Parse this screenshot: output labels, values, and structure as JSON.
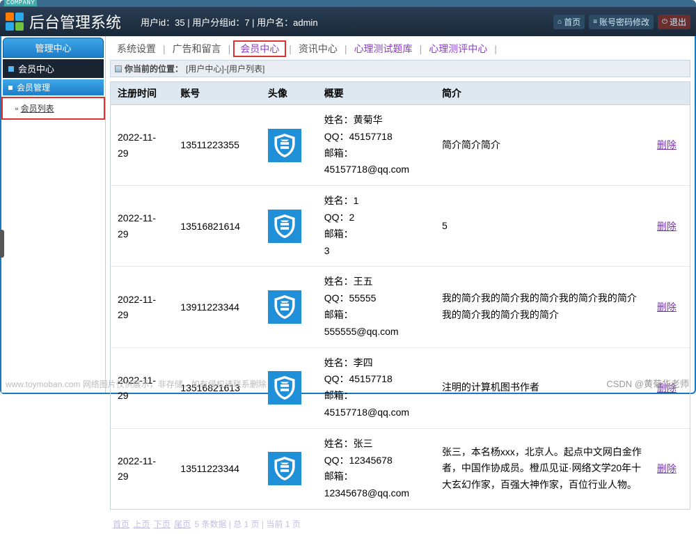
{
  "window": {
    "company_tag": "COMPANY"
  },
  "header": {
    "title": "后台管理系统",
    "user_info": "用户id：35 | 用户分组id：7 | 用户名：admin",
    "links": {
      "home": "首页",
      "pwd": "账号密码修改",
      "exit": "退出"
    }
  },
  "sidebar": {
    "head": "管理中心",
    "sub": "会员中心",
    "group": "会员管理",
    "item": "会员列表"
  },
  "tabs": {
    "items": [
      {
        "label": "系统设置",
        "active": false
      },
      {
        "label": "广告和留言",
        "active": false
      },
      {
        "label": "会员中心",
        "active": true,
        "highlight": true
      },
      {
        "label": "资讯中心",
        "active": false
      },
      {
        "label": "心理测试题库",
        "active": true
      },
      {
        "label": "心理测评中心",
        "active": true
      }
    ],
    "sep": "|"
  },
  "breadcrumb": {
    "label": "你当前的位置：",
    "path": "[用户中心]-[用户列表]"
  },
  "table": {
    "headers": {
      "time": "注册时间",
      "account": "账号",
      "avatar": "头像",
      "summary": "概要",
      "intro": "简介",
      "op": ""
    },
    "summary_labels": {
      "name": "姓名：",
      "qq": "QQ：",
      "email": "邮箱："
    },
    "delete_label": "删除",
    "rows": [
      {
        "time": "2022-11-29",
        "account": "13511223355",
        "name": "黄菊华",
        "qq": "45157718",
        "email": "45157718@qq.com",
        "intro": "简介简介简介"
      },
      {
        "time": "2022-11-29",
        "account": "13516821614",
        "name": "1",
        "qq": "2",
        "email": "3",
        "intro": "5"
      },
      {
        "time": "2022-11-29",
        "account": "13911223344",
        "name": "王五",
        "qq": "55555",
        "email": "555555@qq.com",
        "intro": "我的简介我的简介我的简介我的简介我的简介我的简介我的简介我的简介"
      },
      {
        "time": "2022-11-29",
        "account": "13516821613",
        "name": "李四",
        "qq": "45157718",
        "email": "45157718@qq.com",
        "intro": "注明的计算机图书作者"
      },
      {
        "time": "2022-11-29",
        "account": "13511223344",
        "name": "张三",
        "qq": "12345678",
        "email": "12345678@qq.com",
        "intro": "张三，本名杨xxx，北京人。起点中文网白金作者，中国作协成员。橙瓜见证·网络文学20年十大玄幻作家，百强大神作家，百位行业人物。"
      }
    ]
  },
  "pager": {
    "first": "首页",
    "prev": "上页",
    "next": "下页",
    "last": "尾页",
    "info": "5 条数据 | 总 1 页 | 当前 1 页"
  },
  "watermarks": {
    "left": "www.toymoban.com  网络图片仅供展示，非存储，如有侵权请联系删除",
    "right": "CSDN @黄菊华老师"
  }
}
